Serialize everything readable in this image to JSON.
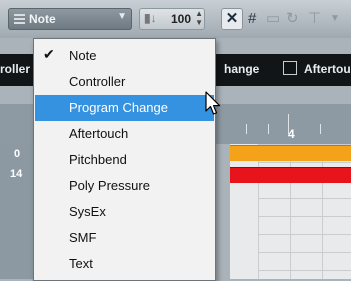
{
  "toolbar": {
    "event_type_value": "Note",
    "velocity_value": "100",
    "icons": [
      "event-type-icon",
      "dropdown-arrow-icon",
      "velocity-icon",
      "spin-icon",
      "snap-x-icon",
      "grid-icon",
      "quantize-icon",
      "loop-icon",
      "insert-velocity-icon"
    ]
  },
  "header_bar": {
    "left_text": "roller",
    "right_text": "hange",
    "checkbox_label": "Aftertou"
  },
  "ruler": {
    "bar_label": "4"
  },
  "lanes": {
    "values": [
      "0",
      "14"
    ]
  },
  "menu": {
    "items": [
      {
        "label": "Note",
        "checked": true
      },
      {
        "label": "Controller"
      },
      {
        "label": "Program Change",
        "highlighted": true
      },
      {
        "label": "Aftertouch"
      },
      {
        "label": "Pitchbend"
      },
      {
        "label": "Poly Pressure"
      },
      {
        "label": "SysEx"
      },
      {
        "label": "SMF"
      },
      {
        "label": "Text"
      }
    ],
    "check_mark": "✔"
  },
  "colors": {
    "highlight": "#3592e0",
    "note_orange": "#f5a21b",
    "note_red": "#e8141b"
  }
}
